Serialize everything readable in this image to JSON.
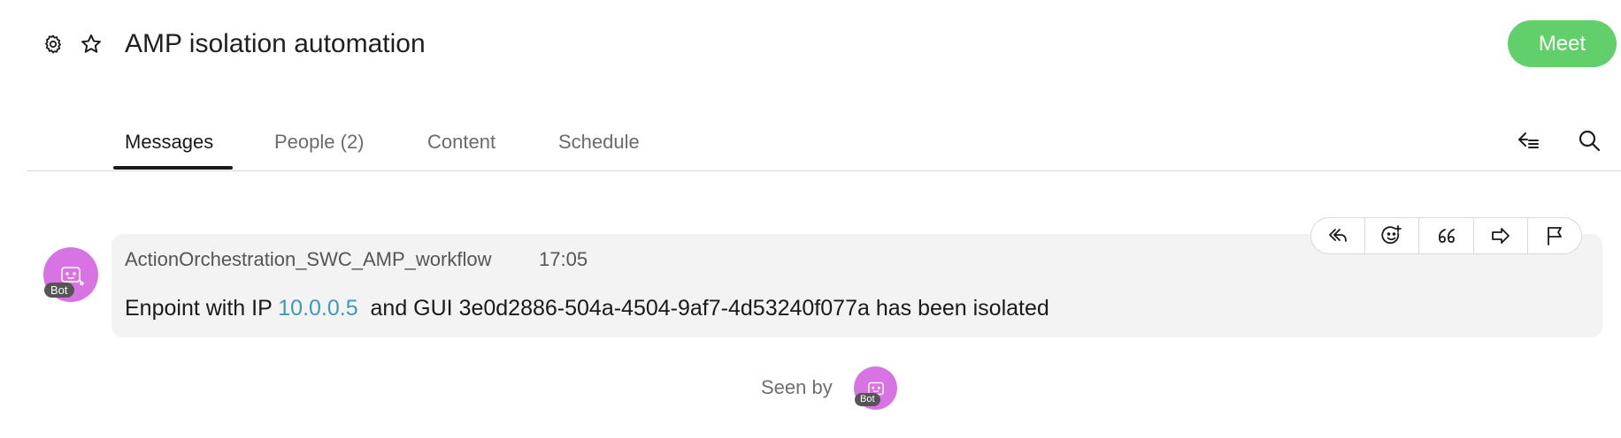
{
  "header": {
    "title": "AMP isolation automation",
    "meet_label": "Meet",
    "settings_icon": "gear-icon",
    "favorite_icon": "star-icon"
  },
  "tabs": [
    {
      "label": "Messages",
      "active": true
    },
    {
      "label": "People (2)",
      "active": false
    },
    {
      "label": "Content",
      "active": false
    },
    {
      "label": "Schedule",
      "active": false
    }
  ],
  "toolbar": {
    "threads_icon": "threads-filter-icon",
    "search_icon": "search-icon"
  },
  "message": {
    "sender": "ActionOrchestration_SWC_AMP_workflow",
    "time": "17:05",
    "badge": "Bot",
    "text_prefix": "Enpoint with IP ",
    "ip": "10.0.0.5",
    "text_suffix": "  and GUI 3e0d2886-504a-4504-9af7-4d53240f077a has been isolated",
    "actions": [
      "reply-icon",
      "add-reaction-icon",
      "quote-icon",
      "forward-icon",
      "flag-icon"
    ]
  },
  "seen": {
    "label": "Seen by",
    "badge": "Bot"
  },
  "colors": {
    "meet": "#61cf6a",
    "avatar": "#d873e3",
    "link": "#3d9bb5",
    "card": "#f3f3f3"
  }
}
